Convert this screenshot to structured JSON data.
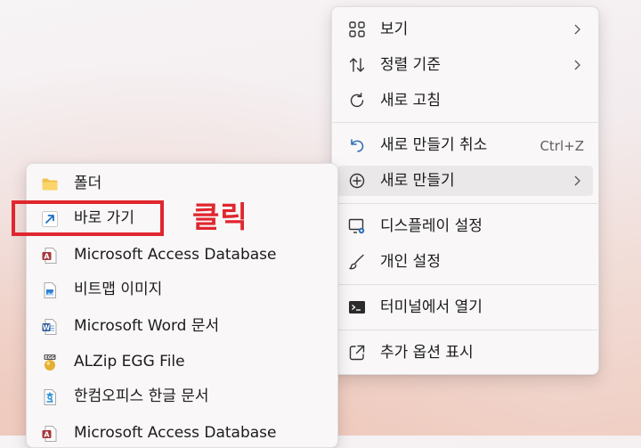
{
  "context_menu": {
    "items": [
      {
        "label": "보기",
        "icon": "grid-icon",
        "submenu": true
      },
      {
        "label": "정렬 기준",
        "icon": "sort-arrows-icon",
        "submenu": true
      },
      {
        "label": "새로 고침",
        "icon": "refresh-icon",
        "submenu": false
      },
      {
        "label": "새로 만들기 취소",
        "icon": "undo-icon",
        "shortcut": "Ctrl+Z"
      },
      {
        "label": "새로 만들기",
        "icon": "add-circle-icon",
        "submenu": true
      },
      {
        "label": "디스플레이 설정",
        "icon": "display-settings-icon"
      },
      {
        "label": "개인 설정",
        "icon": "brush-icon"
      },
      {
        "label": "터미널에서 열기",
        "icon": "terminal-icon"
      },
      {
        "label": "추가 옵션 표시",
        "icon": "open-external-icon"
      }
    ]
  },
  "new_submenu": {
    "items": [
      {
        "label": "폴더",
        "icon": "folder-icon"
      },
      {
        "label": "바로 가기",
        "icon": "shortcut-arrow-icon"
      },
      {
        "label": "Microsoft Access Database",
        "icon": "access-icon"
      },
      {
        "label": "비트맵 이미지",
        "icon": "bitmap-icon"
      },
      {
        "label": "Microsoft Word 문서",
        "icon": "word-icon"
      },
      {
        "label": "ALZip EGG File",
        "icon": "egg-file-icon"
      },
      {
        "label": "한컴오피스 한글 문서",
        "icon": "hwp-icon"
      },
      {
        "label": "Microsoft Access Database",
        "icon": "access-icon"
      }
    ]
  },
  "annotation": {
    "click_text": "클릭",
    "highlight_color": "#e0262e"
  },
  "colors": {
    "menu_bg": "#f9f7f8",
    "hover_bg": "#ebe8ea",
    "text": "#1b1b1b",
    "shortcut_text": "#5f5f5f"
  }
}
